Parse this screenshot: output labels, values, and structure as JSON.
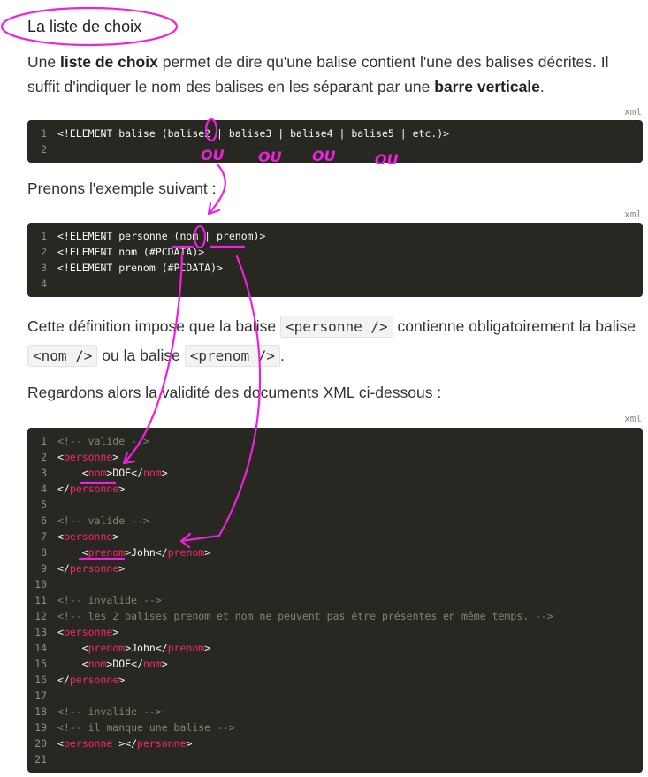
{
  "heading": "La liste de choix",
  "intro": {
    "p1": "Une ",
    "b1": "liste de choix",
    "p2": " permet de dire qu'une balise contient l'une des balises décrites. Il suffit d'indiquer le nom des balises en les séparant par une ",
    "b2": "barre verticale",
    "p3": "."
  },
  "lang_label": "xml",
  "code1": [
    "<!ELEMENT balise (balise2 | balise3 | balise4 | balise5 | etc.)>",
    ""
  ],
  "para2": "Prenons l'exemple suivant :",
  "code2": [
    "<!ELEMENT personne (nom | prenom)>",
    "<!ELEMENT nom (#PCDATA)>",
    "<!ELEMENT prenom (#PCDATA)>",
    ""
  ],
  "para3": {
    "t1": "Cette définition impose que la balise ",
    "c1": "<personne />",
    "t2": " contienne obligatoirement la balise ",
    "c2": "<nom />",
    "t3": " ou la balise ",
    "c3": "<prenom />",
    "t4": "."
  },
  "para4": "Regardons alors la validité des documents XML ci-dessous :",
  "code3": [
    "<!-- valide -->",
    "<personne>",
    "    <nom>DOE</nom>",
    "</personne>",
    "",
    "<!-- valide -->",
    "<personne>",
    "    <prenom>John</prenom>",
    "</personne>",
    "",
    "<!-- invalide -->",
    "<!-- les 2 balises prenom et nom ne peuvent pas être présentes en même temps. -->",
    "<personne>",
    "    <prenom>John</prenom>",
    "    <nom>DOE</nom>",
    "</personne>",
    "",
    "<!-- invalide -->",
    "<!-- il manque une balise -->",
    "<personne ></personne>",
    ""
  ],
  "annotations": [
    "OU",
    "OU",
    "OU",
    "OU"
  ],
  "colors": {
    "code_bg": "#272822",
    "tag": "#f92672",
    "comment": "#88846f",
    "annotation": "#ee22dd"
  }
}
